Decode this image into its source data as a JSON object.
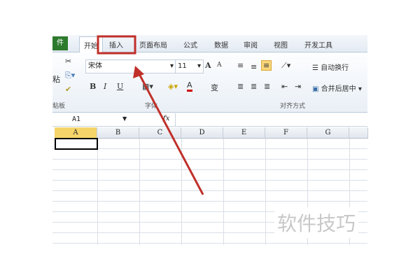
{
  "tabs": [
    "件",
    "开始",
    "插入",
    "页面布局",
    "公式",
    "数据",
    "审阅",
    "视图",
    "开发工具"
  ],
  "ribbon": {
    "paste_label": "粘",
    "font_name": "宋体",
    "font_size": "11",
    "grow": "A",
    "shrink": "A",
    "bold": "B",
    "italic": "I",
    "underline": "U",
    "font_color": "A",
    "phonetic": "变",
    "wrap_text": "自动换行",
    "merge_center": "合并后居中",
    "groups": {
      "clipboard": "粘板",
      "font": "字体",
      "alignment": "对齐方式"
    }
  },
  "formula_bar": {
    "name_box": "A1",
    "fx": "fx"
  },
  "columns": [
    "A",
    "B",
    "C",
    "D",
    "E",
    "F",
    "G"
  ],
  "watermark": "软件技巧",
  "colors": {
    "highlight": "#c0302a",
    "selected_col": "#f5d56a"
  }
}
